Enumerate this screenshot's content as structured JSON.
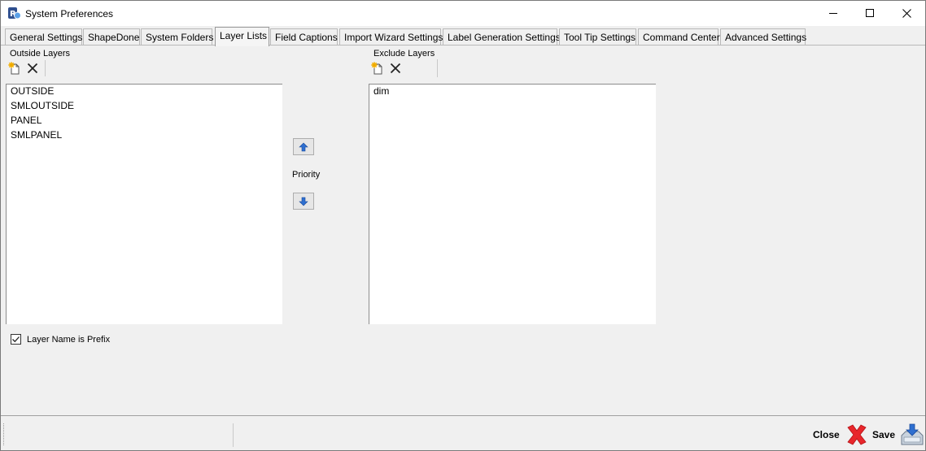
{
  "window": {
    "title": "System Preferences"
  },
  "tabs": [
    {
      "label": "General Settings",
      "active": false
    },
    {
      "label": "ShapeDone",
      "active": false
    },
    {
      "label": "System Folders",
      "active": false
    },
    {
      "label": "Layer Lists",
      "active": true
    },
    {
      "label": "Field Captions",
      "active": false
    },
    {
      "label": "Import Wizard Settings",
      "active": false
    },
    {
      "label": "Label Generation Settings",
      "active": false
    },
    {
      "label": "Tool Tip Settings",
      "active": false
    },
    {
      "label": "Command Center",
      "active": false
    },
    {
      "label": "Advanced Settings",
      "active": false
    }
  ],
  "outside_layers": {
    "label": "Outside Layers",
    "items": [
      "OUTSIDE",
      "SMLOUTSIDE",
      "PANEL",
      "SMLPANEL"
    ]
  },
  "exclude_layers": {
    "label": "Exclude Layers",
    "items": [
      "dim"
    ]
  },
  "priority": {
    "label": "Priority"
  },
  "layer_prefix": {
    "label": "Layer Name is Prefix",
    "checked": true
  },
  "actions": {
    "close_label": "Close",
    "save_label": "Save"
  },
  "colors": {
    "accent_blue": "#2e6fd0",
    "close_red": "#e8262b"
  }
}
